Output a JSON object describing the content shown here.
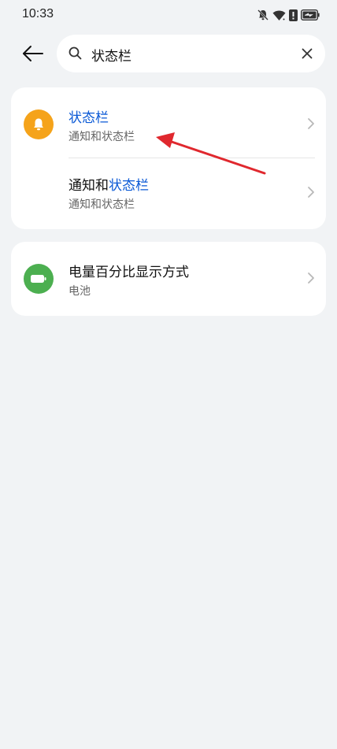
{
  "status_bar": {
    "time": "10:33"
  },
  "search": {
    "value": "状态栏"
  },
  "results": [
    {
      "title_prefix": "",
      "title_highlight": "状态栏",
      "subtitle": "通知和状态栏",
      "icon": "bell-icon",
      "icon_color": "#f5a31a"
    },
    {
      "title_prefix": "通知和",
      "title_highlight": "状态栏",
      "subtitle": "通知和状态栏"
    },
    {
      "title_prefix": "电量百分比显示方式",
      "title_highlight": "",
      "subtitle": "电池",
      "icon": "battery-icon",
      "icon_color": "#4caf50"
    }
  ],
  "colors": {
    "highlight": "#0a59d6",
    "annotation": "#e0282e",
    "background": "#f1f3f5"
  }
}
